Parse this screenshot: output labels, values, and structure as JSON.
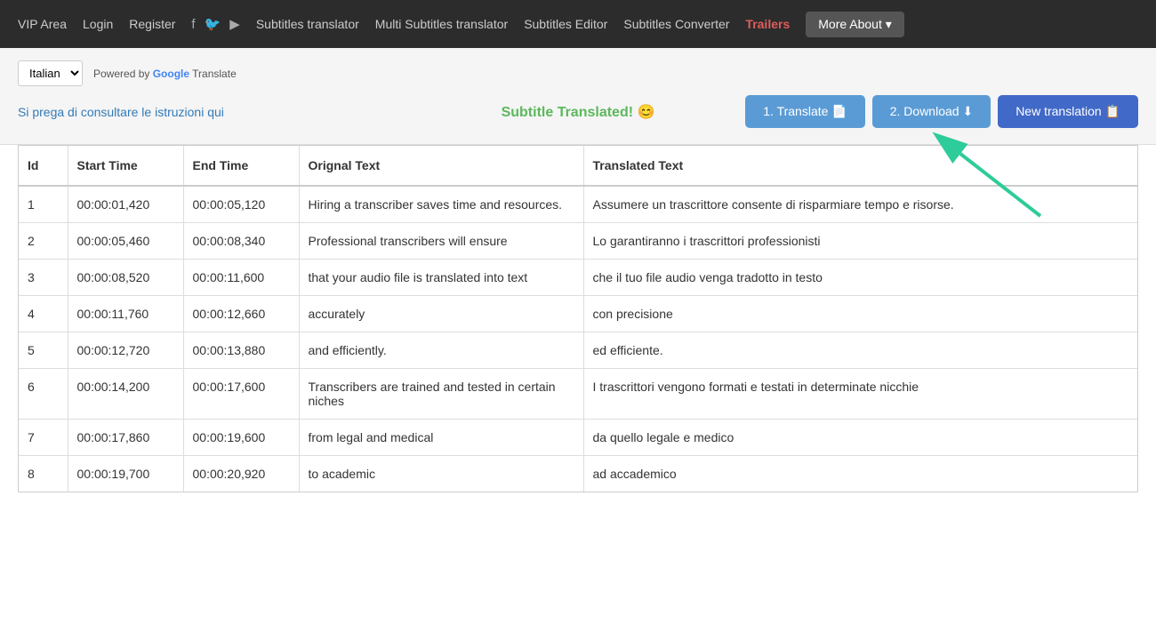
{
  "nav": {
    "links": [
      {
        "label": "VIP Area",
        "href": "#",
        "class": ""
      },
      {
        "label": "Login",
        "href": "#",
        "class": ""
      },
      {
        "label": "Register",
        "href": "#",
        "class": ""
      },
      {
        "label": "Subtitles translator",
        "href": "#",
        "class": ""
      },
      {
        "label": "Multi Subtitles translator",
        "href": "#",
        "class": ""
      },
      {
        "label": "Subtitles Editor",
        "href": "#",
        "class": ""
      },
      {
        "label": "Subtitles Converter",
        "href": "#",
        "class": ""
      },
      {
        "label": "Trailers",
        "href": "#",
        "class": "nav-trailers"
      },
      {
        "label": "More About ▾",
        "href": "#",
        "class": "more-about-btn"
      }
    ],
    "social": [
      "f",
      "🐦",
      "▶"
    ]
  },
  "toolbar": {
    "language_label": "Italian",
    "powered_by_prefix": "Powered by ",
    "powered_by_google": "Google",
    "powered_by_suffix": " Translate",
    "instructions_link": "Si prega di consultare le istruzioni qui",
    "subtitle_translated": "Subtitle Translated! 😊",
    "btn_translate": "1. Translate 📄",
    "btn_download": "2. Download ⬇",
    "btn_new_translation": "New translation 📋"
  },
  "table": {
    "headers": [
      "Id",
      "Start Time",
      "End Time",
      "Orignal Text",
      "Translated Text"
    ],
    "rows": [
      {
        "id": 1,
        "start": "00:00:01,420",
        "end": "00:00:05,120",
        "original": "Hiring a transcriber saves time and resources.",
        "translated": "Assumere un trascrittore consente di risparmiare tempo e risorse."
      },
      {
        "id": 2,
        "start": "00:00:05,460",
        "end": "00:00:08,340",
        "original": "Professional transcribers will ensure",
        "translated": "Lo garantiranno i trascrittori professionisti"
      },
      {
        "id": 3,
        "start": "00:00:08,520",
        "end": "00:00:11,600",
        "original": "that your audio file is translated into text",
        "translated": "che il tuo file audio venga tradotto in testo"
      },
      {
        "id": 4,
        "start": "00:00:11,760",
        "end": "00:00:12,660",
        "original": "accurately",
        "translated": "con precisione"
      },
      {
        "id": 5,
        "start": "00:00:12,720",
        "end": "00:00:13,880",
        "original": "and efficiently.",
        "translated": "ed efficiente."
      },
      {
        "id": 6,
        "start": "00:00:14,200",
        "end": "00:00:17,600",
        "original": "Transcribers are trained and tested in certain niches",
        "translated": "I trascrittori vengono formati e testati in determinate nicchie"
      },
      {
        "id": 7,
        "start": "00:00:17,860",
        "end": "00:00:19,600",
        "original": "from legal and medical",
        "translated": "da quello legale e medico"
      },
      {
        "id": 8,
        "start": "00:00:19,700",
        "end": "00:00:20,920",
        "original": "to academic",
        "translated": "ad accademico"
      }
    ]
  }
}
